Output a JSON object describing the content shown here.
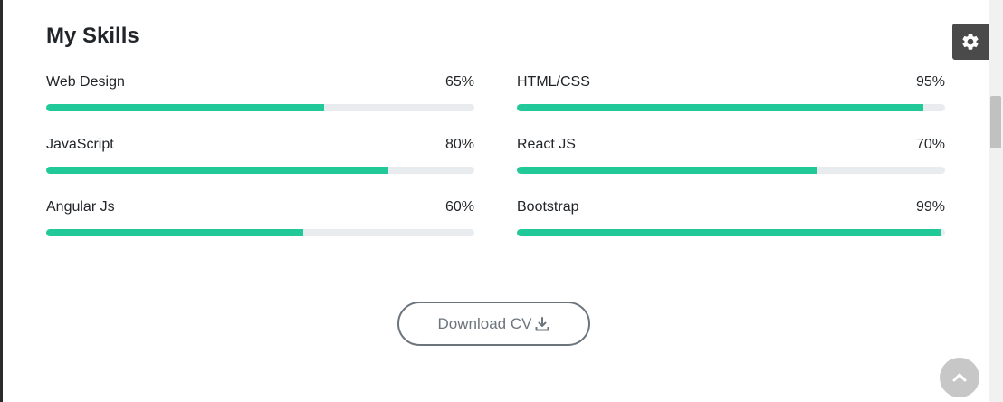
{
  "section": {
    "title": "My Skills"
  },
  "skills": [
    {
      "name": "Web Design",
      "percent_label": "65%",
      "value": 65
    },
    {
      "name": "HTML/CSS",
      "percent_label": "95%",
      "value": 95
    },
    {
      "name": "JavaScript",
      "percent_label": "80%",
      "value": 80
    },
    {
      "name": "React JS",
      "percent_label": "70%",
      "value": 70
    },
    {
      "name": "Angular Js",
      "percent_label": "60%",
      "value": 60
    },
    {
      "name": "Bootstrap",
      "percent_label": "99%",
      "value": 99
    }
  ],
  "download": {
    "label": "Download CV",
    "icon": "download-icon"
  },
  "settings": {
    "icon": "gear-icon"
  },
  "back_to_top": {
    "icon": "chevron-up-icon"
  },
  "colors": {
    "accent": "#20c997",
    "track": "#e9ecef",
    "button_border": "#6c757d",
    "settings_bg": "#4a4a4a"
  }
}
